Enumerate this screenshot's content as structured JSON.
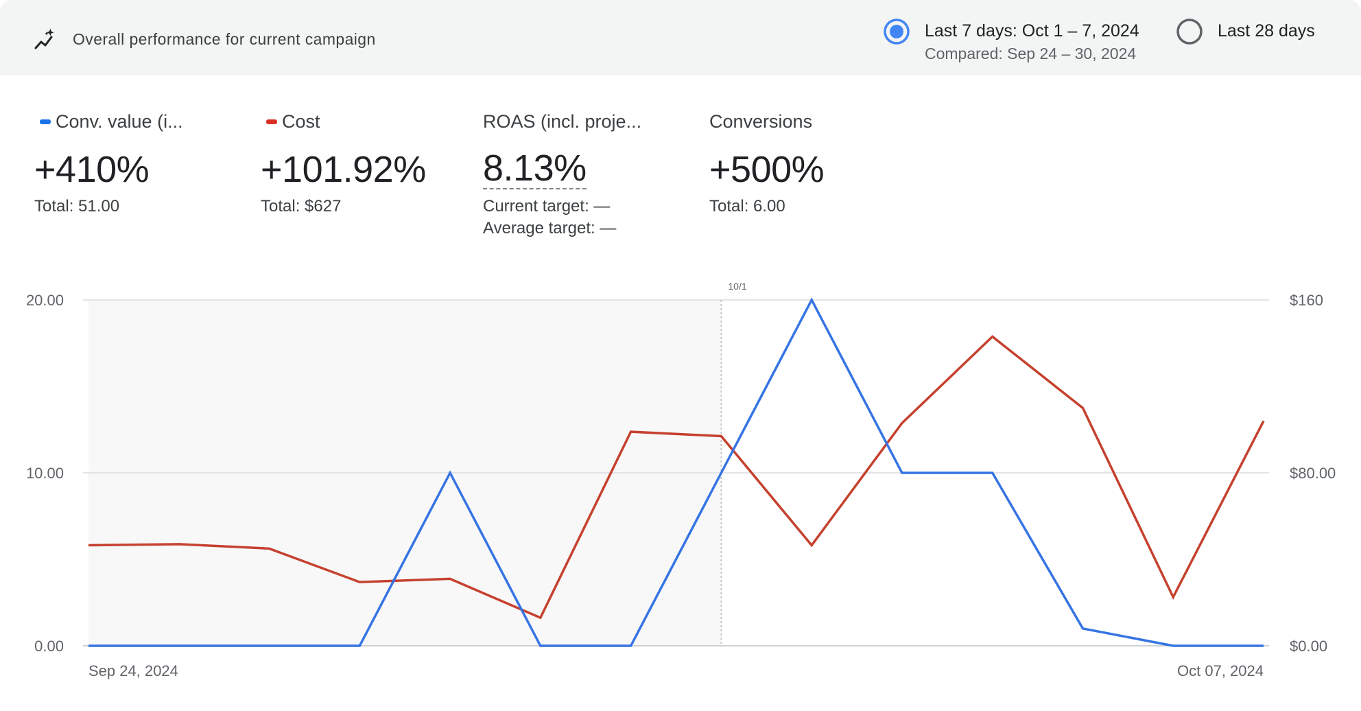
{
  "header": {
    "title": "Overall performance for current campaign",
    "icon": "insights-icon",
    "range_options": [
      {
        "label": "Last 7 days: Oct 1 – 7, 2024",
        "sub": "Compared: Sep 24 – 30, 2024",
        "selected": true
      },
      {
        "label": "Last 28 days",
        "sub": "",
        "selected": false
      }
    ]
  },
  "metrics": [
    {
      "name": "Conv. value (i...",
      "value": "+410%",
      "sub1": "Total: 51.00",
      "sub2": "",
      "color": "#1a73e8"
    },
    {
      "name": "Cost",
      "value": "+101.92%",
      "sub1": "Total: $627",
      "sub2": "",
      "color": "#d93025"
    },
    {
      "name": "ROAS (incl. proje...",
      "value": "8.13%",
      "sub1": "Current target: —",
      "sub2": "Average target: —",
      "color": ""
    },
    {
      "name": "Conversions",
      "value": "+500%",
      "sub1": "Total: 6.00",
      "sub2": "",
      "color": ""
    }
  ],
  "chart_data": {
    "type": "line",
    "x": [
      "Sep 24, 2024",
      "Sep 25, 2024",
      "Sep 26, 2024",
      "Sep 27, 2024",
      "Sep 28, 2024",
      "Sep 29, 2024",
      "Sep 30, 2024",
      "Oct 01, 2024",
      "Oct 02, 2024",
      "Oct 03, 2024",
      "Oct 04, 2024",
      "Oct 05, 2024",
      "Oct 06, 2024",
      "Oct 07, 2024"
    ],
    "x_tick_labels": [
      "Sep 24, 2024",
      "Oct 07, 2024"
    ],
    "marker_label": "10/1",
    "series": [
      {
        "name": "Conv. value (i...",
        "axis": "left",
        "color": "#3574e3",
        "values": [
          0,
          0,
          0,
          0,
          10,
          0,
          0,
          10,
          20,
          10,
          10,
          1,
          0,
          0
        ]
      },
      {
        "name": "Cost",
        "axis": "right",
        "color": "#c5412e",
        "values": [
          46.5,
          47,
          45,
          29.5,
          31,
          13,
          99,
          97,
          46.5,
          103,
          143,
          110,
          22.5,
          104
        ]
      }
    ],
    "left_axis": {
      "ylim": [
        0,
        20
      ],
      "ticks": [
        "0.00",
        "10.00",
        "20.00"
      ]
    },
    "right_axis": {
      "ylim": [
        0,
        160
      ],
      "ticks": [
        "$0.00",
        "$80.00",
        "$160"
      ]
    },
    "comparison_period_shaded": true,
    "grid": true
  }
}
